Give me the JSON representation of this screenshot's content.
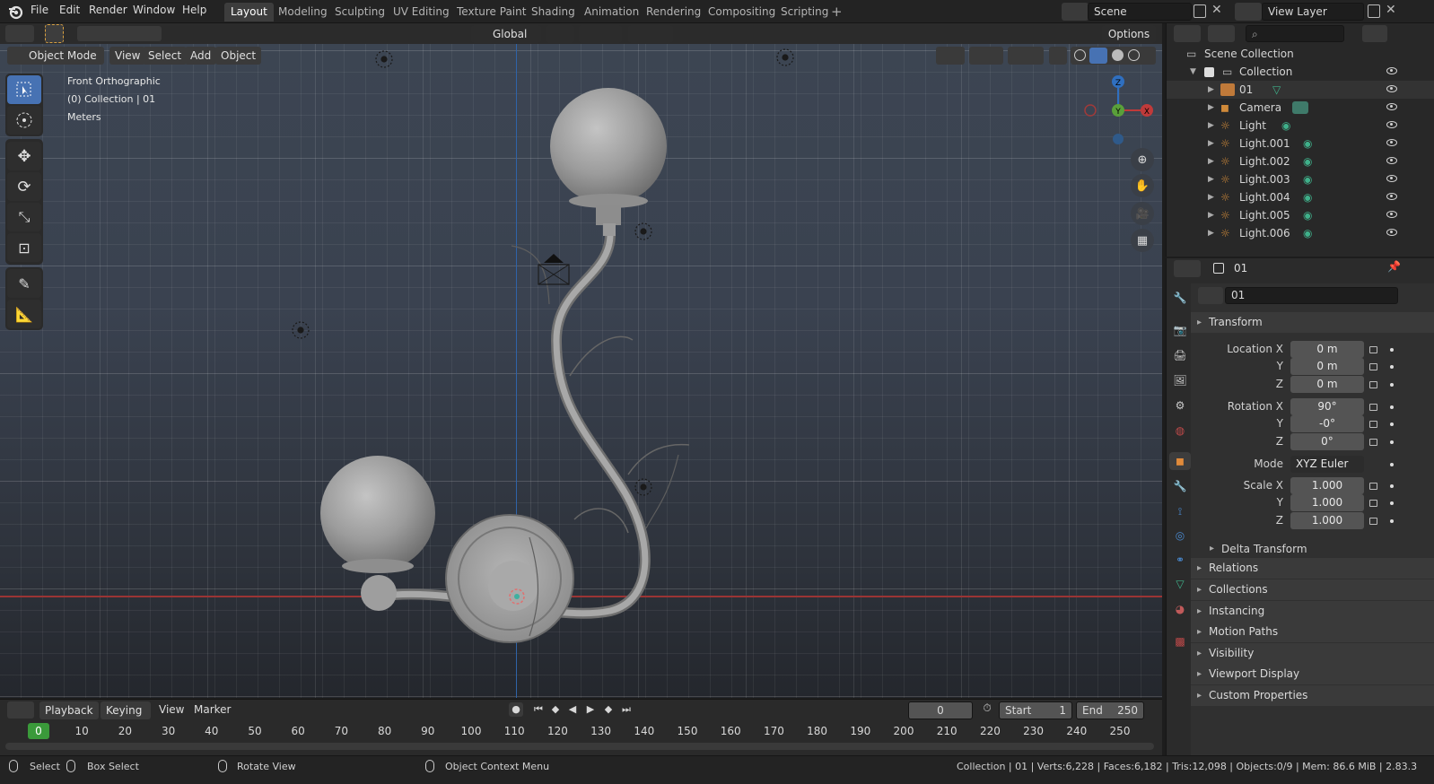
{
  "menu": {
    "items": [
      "File",
      "Edit",
      "Render",
      "Window",
      "Help"
    ]
  },
  "workspaces": [
    "Layout",
    "Modeling",
    "Sculpting",
    "UV Editing",
    "Texture Paint",
    "Shading",
    "Animation",
    "Rendering",
    "Compositing",
    "Scripting"
  ],
  "active_workspace": "Layout",
  "scene": {
    "name": "Scene",
    "view_layer": "View Layer"
  },
  "toolbar": {
    "orientation": "Global",
    "options": "Options"
  },
  "viewport": {
    "mode": "Object Mode",
    "menus": [
      "View",
      "Select",
      "Add",
      "Object"
    ],
    "info_lines": [
      "Front Orthographic",
      "(0) Collection | 01",
      "Meters"
    ],
    "gizmo": {
      "z": "Z",
      "y": "Y",
      "x": "X"
    }
  },
  "outliner": {
    "search_placeholder": "",
    "root": "Scene Collection",
    "collection": "Collection",
    "items": [
      "01",
      "Camera",
      "Light",
      "Light.001",
      "Light.002",
      "Light.003",
      "Light.004",
      "Light.005",
      "Light.006"
    ]
  },
  "properties": {
    "object_name": "01",
    "name_field": "01",
    "transform_title": "Transform",
    "location": {
      "label": "Location X",
      "x": "0 m",
      "y": "0 m",
      "z": "0 m"
    },
    "rotation": {
      "label": "Rotation X",
      "x": "90°",
      "y": "-0°",
      "z": "0°"
    },
    "mode": {
      "label": "Mode",
      "value": "XYZ Euler"
    },
    "scale": {
      "label": "Scale X",
      "x": "1.000",
      "y": "1.000",
      "z": "1.000"
    },
    "axis_labels": {
      "y": "Y",
      "z": "Z"
    },
    "delta": "Delta Transform",
    "panels": [
      "Relations",
      "Collections",
      "Instancing",
      "Motion Paths",
      "Visibility",
      "Viewport Display",
      "Custom Properties"
    ]
  },
  "timeline": {
    "menus": [
      "Playback",
      "Keying",
      "View",
      "Marker"
    ],
    "current_frame": "0",
    "start_label": "Start",
    "start": "1",
    "end_label": "End",
    "end": "250",
    "ticks": [
      "0",
      "10",
      "20",
      "30",
      "40",
      "50",
      "60",
      "70",
      "80",
      "90",
      "100",
      "110",
      "120",
      "130",
      "140",
      "150",
      "160",
      "170",
      "180",
      "190",
      "200",
      "210",
      "220",
      "230",
      "240",
      "250"
    ]
  },
  "status": {
    "select": "Select",
    "box_select": "Box Select",
    "rotate_view": "Rotate View",
    "context_menu": "Object Context Menu",
    "stats": "Collection | 01 | Verts:6,228 | Faces:6,182 | Tris:12,098 | Objects:0/9 | Mem: 86.6 MiB | 2.83.3"
  },
  "colors": {
    "accent": "#4772b3",
    "active_frame": "#3a9a3a",
    "axis_x": "#c03a3a",
    "axis_z": "#2f6fc0"
  }
}
